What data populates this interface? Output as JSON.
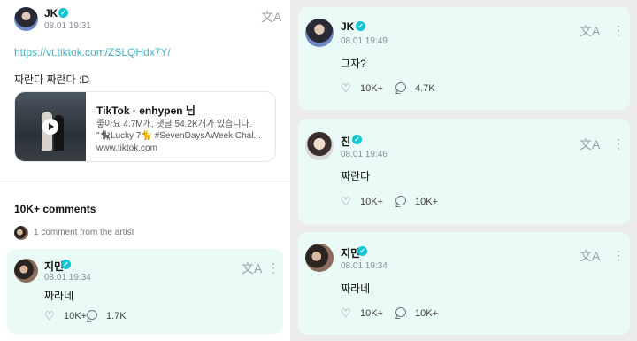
{
  "post": {
    "author": "JK",
    "date": "08.01 19:31",
    "link": "https://vt.tiktok.com/ZSLQHdx7Y/",
    "text": "짜란다 짜란다 :D",
    "card": {
      "title": "TikTok · enhypen 님",
      "desc_line1": "좋아요 4.7M개, 댓글 54.2K개가 있습니다.",
      "desc_line2": "\"🐈‍⬛Lucky 7🐈 #SevenDaysAWeek Chal...",
      "url": "www.tiktok.com"
    }
  },
  "comments_section": {
    "count": "10K+ comments",
    "artist_note": "1 comment from the artist"
  },
  "left_comment": {
    "author": "지민",
    "date": "08.01 19:34",
    "text": "짜라네",
    "likes": "10K+",
    "replies": "1.7K"
  },
  "right_comments": [
    {
      "author": "JK",
      "date": "08.01 19:49",
      "text": "그자?",
      "likes": "10K+",
      "replies": "4.7K"
    },
    {
      "author": "진",
      "date": "08.01 19:46",
      "text": "짜란다",
      "likes": "10K+",
      "replies": "10K+"
    },
    {
      "author": "지민",
      "date": "08.01 19:34",
      "text": "짜라네",
      "likes": "10K+",
      "replies": "10K+"
    }
  ],
  "icons": {
    "translate": "文A",
    "more": "⋮",
    "verified": "✓",
    "like": "♡"
  },
  "colors": {
    "accent": "#12c4d6",
    "link": "#3bb5c9",
    "comment_bg": "#e9faf7"
  }
}
